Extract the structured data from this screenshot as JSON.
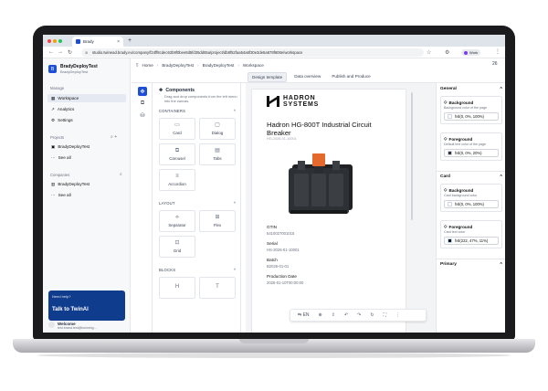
{
  "browser": {
    "tab_title": "Brady",
    "tab_close": "×",
    "new_tab": "+",
    "url": "studio.twinead.brady.eu/company/f24ff8cdec62b9f0bee8d5fd35dd65a/project/db8f52faa54a6f30e3de5a678f608e/workspace",
    "profile_label": "Work",
    "back": "←",
    "forward": "→",
    "reload": "↻",
    "star": "☆",
    "ext": "⚙",
    "kebab": "⋮"
  },
  "sidebar": {
    "org_name": "BradyDeployTest",
    "org_sub": "BradyDeployTest",
    "manage_label": "Manage",
    "items": [
      {
        "icon": "▦",
        "label": "Workspace"
      },
      {
        "icon": "↗",
        "label": "Analytics"
      },
      {
        "icon": "⚙",
        "label": "Settings"
      }
    ],
    "projects_label": "Projects",
    "projects_actions": "⌕  +",
    "project_item": "BradyDeployTest",
    "projects_see_all": "See all",
    "companies_label": "Companies",
    "companies_action": "⌕",
    "company_item": "BradyDeployTest",
    "companies_see_all": "See all",
    "help_small": "Need help?",
    "help_big": "Talk to TwinAI",
    "user_name": "Welcome",
    "user_mail": "test.brand.test@twinning..."
  },
  "header": {
    "breadcrumbs": [
      "Home",
      "BradyDeployTest",
      "BradyDeployTest",
      "Workspace"
    ],
    "counter": "26",
    "tabs": [
      "Design template",
      "Data overview",
      "Publish and Produce"
    ]
  },
  "components": {
    "title": "Components",
    "description": "Drag and drop components from the left menu into the canvas.",
    "containers_label": "CONTAINERS",
    "layout_label": "LAYOUT",
    "blocks_label": "BLOCKS",
    "containers": [
      {
        "icon": "▭",
        "label": "Card"
      },
      {
        "icon": "▢",
        "label": "Dialog"
      },
      {
        "icon": "⧉",
        "label": "Carousel"
      },
      {
        "icon": "▤",
        "label": "Tabs"
      },
      {
        "icon": "≡",
        "label": "Accordion"
      }
    ],
    "layout": [
      {
        "icon": "⟡",
        "label": "Separator"
      },
      {
        "icon": "⊞",
        "label": "Flex"
      },
      {
        "icon": "⊡",
        "label": "Grid"
      }
    ],
    "blocks": [
      {
        "icon": "H",
        "label": ""
      },
      {
        "icon": "T",
        "label": ""
      }
    ]
  },
  "canvas": {
    "brand_line1": "HADRON",
    "brand_line2": "SYSTEMS",
    "product_title": "Hadron HG-800T Industrial Circuit Breaker",
    "product_sub": "HG-2026-01-10001",
    "fields": [
      {
        "label": "GTIN",
        "value": "5410027001015"
      },
      {
        "label": "Serial",
        "value": "HS-2026-01-10001"
      },
      {
        "label": "Batch",
        "value": "B2026-01-01"
      },
      {
        "label": "Production Date",
        "value": "2026-01-10T00:00:00"
      }
    ],
    "toolbar": [
      "⇆ EN",
      "⊕",
      "⇪",
      "↶",
      "↷",
      "↻",
      "⛶",
      "⋮"
    ]
  },
  "properties": {
    "general_label": "General",
    "card_label": "Card",
    "primary_label": "Primary",
    "boxes": [
      {
        "title": "Background",
        "desc": "Background color of the page",
        "value": "hsl(0, 0%, 100%)",
        "swatch": "#ffffff"
      },
      {
        "title": "Foreground",
        "desc": "Default text color of the page",
        "value": "hsl(0, 0%, 20%)",
        "swatch": "#333333"
      },
      {
        "title": "Background",
        "desc": "Card background color",
        "value": "hsl(0, 0%, 100%)",
        "swatch": "#ffffff"
      },
      {
        "title": "Foreground",
        "desc": "Card text color",
        "value": "hsl(222, 47%, 11%)",
        "swatch": "#0f172a"
      }
    ],
    "chevron_up": "^",
    "drop_icon": "◇"
  },
  "colors": {
    "accent": "#1d4ed8",
    "help_card": "#0f3c8c",
    "active_nav": "#e5e9f2"
  }
}
